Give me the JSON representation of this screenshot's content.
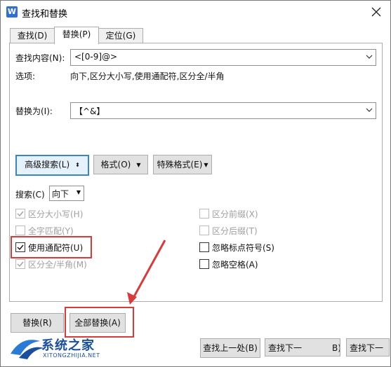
{
  "window": {
    "title": "查找和替换",
    "app_icon_letter": "W"
  },
  "tabs": [
    {
      "label": "查找(D)",
      "active": false
    },
    {
      "label": "替换(P)",
      "active": true
    },
    {
      "label": "定位(G)",
      "active": false
    }
  ],
  "find": {
    "label": "查找内容(N):",
    "value": "<[0-9]@>"
  },
  "options": {
    "label": "选项:",
    "value": "向下,区分大小写,使用通配符,区分全/半角"
  },
  "replace": {
    "label": "替换为(I):",
    "value": "【^&】"
  },
  "buttons": {
    "advanced": "高级搜索(L)",
    "advanced_glyph": "⬍",
    "format": "格式(O)",
    "special": "特殊格式(E)",
    "replace": "替换(R)",
    "replace_all": "全部替换(A)",
    "find_prev": "查找上一处(B)",
    "find_next_partial": "查找下一",
    "find_next_hidden_tail": "B)",
    "find_next_2": "查找下一"
  },
  "search": {
    "label": "搜索(C)",
    "value": "向下"
  },
  "checkboxes": {
    "match_case": {
      "label": "区分大小写(H)",
      "checked": true,
      "disabled": true
    },
    "whole_word": {
      "label": "全字匹配(Y)",
      "checked": false,
      "disabled": true
    },
    "wildcards": {
      "label": "使用通配符(U)",
      "checked": true,
      "disabled": false
    },
    "full_half": {
      "label": "区分全/半角(M)",
      "checked": true,
      "disabled": true
    },
    "prefix": {
      "label": "区分前缀(X)",
      "checked": false,
      "disabled": true
    },
    "suffix": {
      "label": "区分后缀(T)",
      "checked": false,
      "disabled": true
    },
    "ignore_punct": {
      "label": "忽略标点符号(S)",
      "checked": false,
      "disabled": false
    },
    "ignore_space": {
      "label": "忽略空格(A)",
      "checked": false,
      "disabled": false
    }
  },
  "watermark": {
    "text": "系统之家",
    "sub": "XITONGZHIJIA.NET"
  },
  "colors": {
    "highlight": "#d93a3a",
    "focus": "#3d84c6"
  }
}
